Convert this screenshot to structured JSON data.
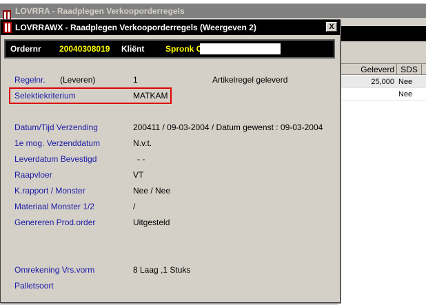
{
  "background_window": {
    "title": "LOVRRA - Raadplegen Verkooporderregels",
    "grid": {
      "columns": [
        "Geleverd",
        "SDS"
      ],
      "rows": [
        {
          "geleverd": "25,000",
          "sds": "Nee"
        },
        {
          "geleverd": "",
          "sds": "Nee"
        }
      ]
    }
  },
  "dialog": {
    "title": "LOVRRAWX - Raadplegen Verkooporderregels (Weergeven 2)",
    "close_label": "X",
    "order_bar": {
      "ordernr_label": "Ordernr",
      "ordernr_value": "20040308019",
      "client_label": "Kliënt",
      "client_value": "Spronk Ci"
    },
    "fields": {
      "regelnr_label": "Regelnr.",
      "regelnr_sub": "(Leveren)",
      "regelnr_value": "1",
      "regelnr_status": "Artikelregel geleverd",
      "selektie_label": "Selektiekriterium",
      "selektie_value": "MATKAM",
      "datum_label": "Datum/Tijd Verzending",
      "datum_value": "200411 / 09-03-2004 / Datum gewenst : 09-03-2004",
      "mog_label": "1e mog. Verzenddatum",
      "mog_value": "N.v.t.",
      "leverdatum_label": "Leverdatum Bevestigd",
      "leverdatum_value": "- -",
      "raapvloer_label": "Raapvloer",
      "raapvloer_value": "VT",
      "krapport_label": "K.rapport / Monster",
      "krapport_value": "Nee / Nee",
      "materiaal_label": "Materiaal Monster 1/2",
      "materiaal_value": "/",
      "genereren_label": "Genereren Prod.order",
      "genereren_value": "Uitgesteld",
      "omrekening_label": "Omrekening Vrs.vorm",
      "omrekening_value": "8 Laag ,1 Stuks",
      "palletsoort_label": "Palletsoort",
      "palletsoort_value": ""
    }
  },
  "colors": {
    "label_blue": "#1a1aa6",
    "order_yellow": "#ffff00",
    "highlight_red": "#e00000",
    "dialog_gray": "#d4d0c8"
  }
}
